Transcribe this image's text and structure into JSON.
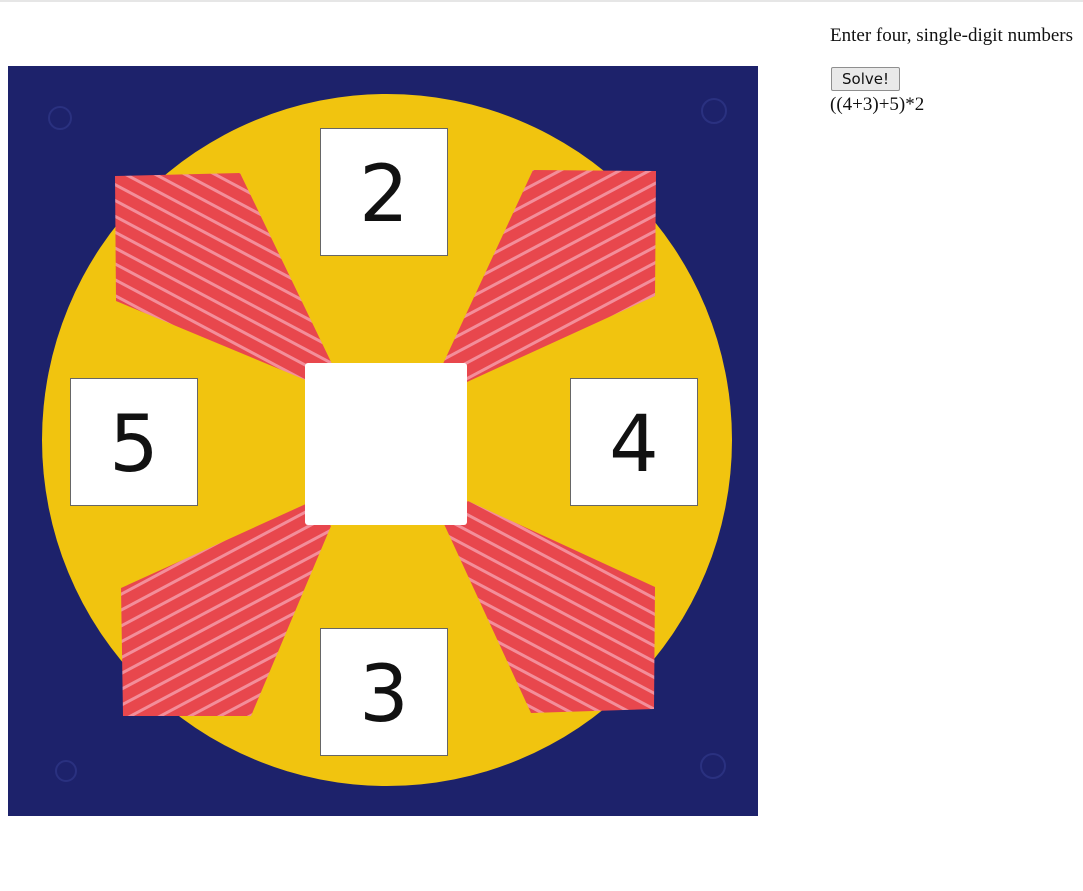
{
  "board": {
    "numbers": {
      "top": "2",
      "left": "5",
      "right": "4",
      "bottom": "3"
    },
    "colors": {
      "background": "#1d226b",
      "disc": "#f1c40f",
      "beams": "#e8474d",
      "beam_stripes": "#f7a3b0"
    }
  },
  "controls": {
    "prompt": "Enter four, single-digit numbers",
    "solve_label": "Solve!",
    "result": "((4+3)+5)*2"
  }
}
